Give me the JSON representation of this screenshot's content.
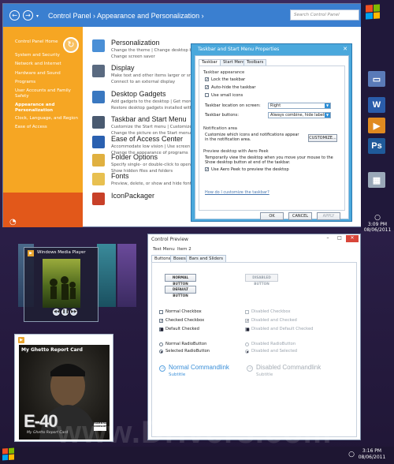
{
  "control_panel": {
    "back_glyph": "←",
    "forward_glyph": "→",
    "breadcrumb": "Control Panel   ›   Appearance and Personalization   ›",
    "search_placeholder": "Search Control Panel",
    "sidebar": [
      "Control Panel Home",
      "System and Security",
      "Network and Internet",
      "Hardware and Sound",
      "Programs",
      "User Accounts and Family Safety",
      "Appearance and Personalization",
      "Clock, Language, and Region",
      "Ease of Access"
    ],
    "categories": [
      {
        "title": "Personalization",
        "subs": [
          "Change the theme   |   Change desktop background",
          "Change screen saver"
        ],
        "color": "#4a8fd6"
      },
      {
        "title": "Display",
        "subs": [
          "Make text and other items larger or smaller",
          "Connect to an external display"
        ],
        "color": "#5a6a80"
      },
      {
        "title": "Desktop Gadgets",
        "subs": [
          "Add gadgets to the desktop   |   Get more gadgets online",
          "Restore desktop gadgets installed with Windows"
        ],
        "color": "#3a78c0"
      },
      {
        "title": "Taskbar and Start Menu",
        "subs": [
          "Customize the Start menu   |   Customize icons on the taskbar",
          "Change the picture on the Start menu"
        ],
        "color": "#4a5a70"
      },
      {
        "title": "Ease of Access Center",
        "subs": [
          "Accommodate low vision   |   Use screen reader",
          "Change the appearance of programs"
        ],
        "color": "#2a60b0"
      },
      {
        "title": "Folder Options",
        "subs": [
          "Specify single- or double-click to open",
          "Show hidden files and folders"
        ],
        "color": "#e0b040"
      },
      {
        "title": "Fonts",
        "subs": [
          "Preview, delete, or show and hide fonts"
        ],
        "color": "#e8c050"
      },
      {
        "title": "IconPackager",
        "subs": [],
        "color": "#c84028"
      }
    ]
  },
  "taskbar_dialog": {
    "title": "Taskbar and Start Menu Properties",
    "close": "✕",
    "tabs": [
      "Taskbar",
      "Start Menu",
      "Toolbars"
    ],
    "appearance_label": "Taskbar appearance",
    "checks": [
      {
        "label": "Lock the taskbar",
        "checked": true
      },
      {
        "label": "Auto-hide the taskbar",
        "checked": true
      },
      {
        "label": "Use small icons",
        "checked": false
      }
    ],
    "location_label": "Taskbar location on screen:",
    "location_value": "Right",
    "buttons_label": "Taskbar buttons:",
    "buttons_value": "Always combine, hide labels",
    "notification_label": "Notification area",
    "notification_text": "Customize which icons and notifications appear in the notification area.",
    "customize_button": "CUSTOMIZE...",
    "peek_label": "Preview desktop with Aero Peek",
    "peek_text": "Temporarily view the desktop when you move your mouse to the Show desktop button at end of the taskbar.",
    "peek_check": "Use Aero Peek to preview the desktop",
    "help_link": "How do I customize the taskbar?",
    "ok": "OK",
    "cancel": "CANCEL",
    "apply": "APPLY"
  },
  "media_player": {
    "title": "Windows Media Player",
    "prev": "◀◀",
    "pause": "❚❚",
    "next": "▶▶"
  },
  "album": {
    "play_glyph": "▶",
    "card_title": "My Ghetto Report Card",
    "artist": "E-40",
    "subtitle": "My Ghetto Report Card",
    "advisory": "PARENTAL ADVISORY"
  },
  "preview": {
    "title": "Control Preview",
    "min": "–",
    "max": "□",
    "close": "✕",
    "menu": [
      "Test Menu",
      "Item 2"
    ],
    "tabs": [
      "Buttons",
      "Boxes",
      "Bars and Sliders"
    ],
    "buttons": {
      "normal": "NORMAL BUTTON",
      "default": "DEFAULT BUTTON",
      "disabled": "DISABLED BUTTON"
    },
    "checkboxes_left": [
      {
        "label": "Normal Checkbox",
        "state": "off"
      },
      {
        "label": "Checked Checkbox",
        "state": "on"
      },
      {
        "label": "Default Checked",
        "state": "default"
      }
    ],
    "checkboxes_right": [
      {
        "label": "Disabled Checkbox",
        "state": "off"
      },
      {
        "label": "Disabled and Checked",
        "state": "on"
      },
      {
        "label": "Disabled and Default Checked",
        "state": "default"
      }
    ],
    "radios_left": [
      {
        "label": "Normal RadioButton",
        "selected": false
      },
      {
        "label": "Selected RadioButton",
        "selected": true
      }
    ],
    "radios_right": [
      {
        "label": "Disabled RadioButton",
        "selected": false
      },
      {
        "label": "Disabled and Selected",
        "selected": true
      }
    ],
    "cmd_arrow": "→",
    "cmd_normal_title": "Normal Commandlink",
    "cmd_disabled_title": "Disabled Commandlink",
    "cmd_sub": "Subtitle"
  },
  "taskbar_right": {
    "icons": [
      {
        "name": "window-icon",
        "glyph": "▭",
        "color": "#5a7ab8"
      },
      {
        "name": "word-icon",
        "glyph": "W",
        "color": "#2a5caa"
      },
      {
        "name": "media-icon",
        "glyph": "▶",
        "color": "#e08a20"
      },
      {
        "name": "photoshop-icon",
        "glyph": "Ps",
        "color": "#1f5a9a"
      },
      {
        "name": "explorer-icon",
        "glyph": "▦",
        "color": "#9aa8b8"
      }
    ],
    "clock_time": "3:09 PM",
    "clock_date": "08/06/2011"
  },
  "taskbar_bottom": {
    "clock_time": "3:16 PM",
    "clock_date": "08/06/2011"
  },
  "watermark": "www.Drivers.com",
  "colors": {
    "accent_blue": "#3a7fd0",
    "sidebar_orange": "#f6a623",
    "sidebar_red": "#e2581a",
    "dialog_blue": "#4aa8dc"
  }
}
